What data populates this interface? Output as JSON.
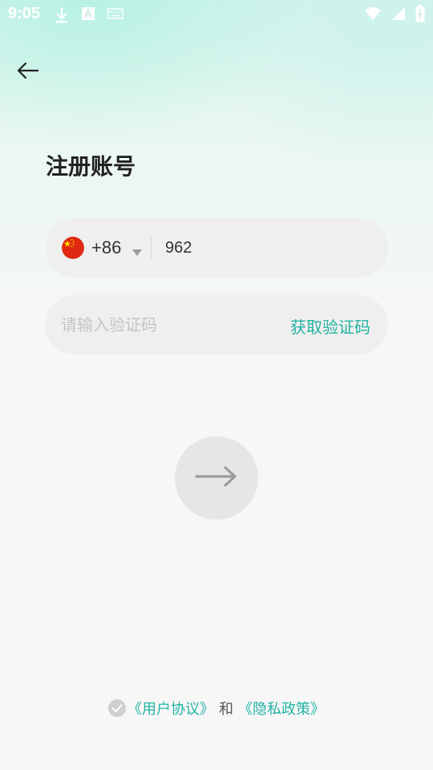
{
  "status_bar": {
    "time": "9:05",
    "left_icons": [
      "download-icon",
      "text-a-icon",
      "keyboard-icon"
    ],
    "right_icons": [
      "wifi-icon",
      "signal-icon",
      "battery-icon"
    ]
  },
  "header": {
    "back_icon": "arrow-left-icon",
    "title": "注册账号"
  },
  "phone_field": {
    "flag_icon": "china-flag-icon",
    "country_code": "+86",
    "value": "962"
  },
  "code_field": {
    "placeholder": "请输入验证码",
    "get_code_label": "获取验证码"
  },
  "submit": {
    "icon": "arrow-right-icon"
  },
  "agreement": {
    "user_agreement": "《用户协议》",
    "conjunction": "和",
    "privacy_policy": "《隐私政策》",
    "checked": false
  },
  "colors": {
    "accent": "#21b3a3",
    "field_bg": "#efefef",
    "page_bg": "#f7f7f7",
    "submit_bg": "#e6e6e6"
  }
}
